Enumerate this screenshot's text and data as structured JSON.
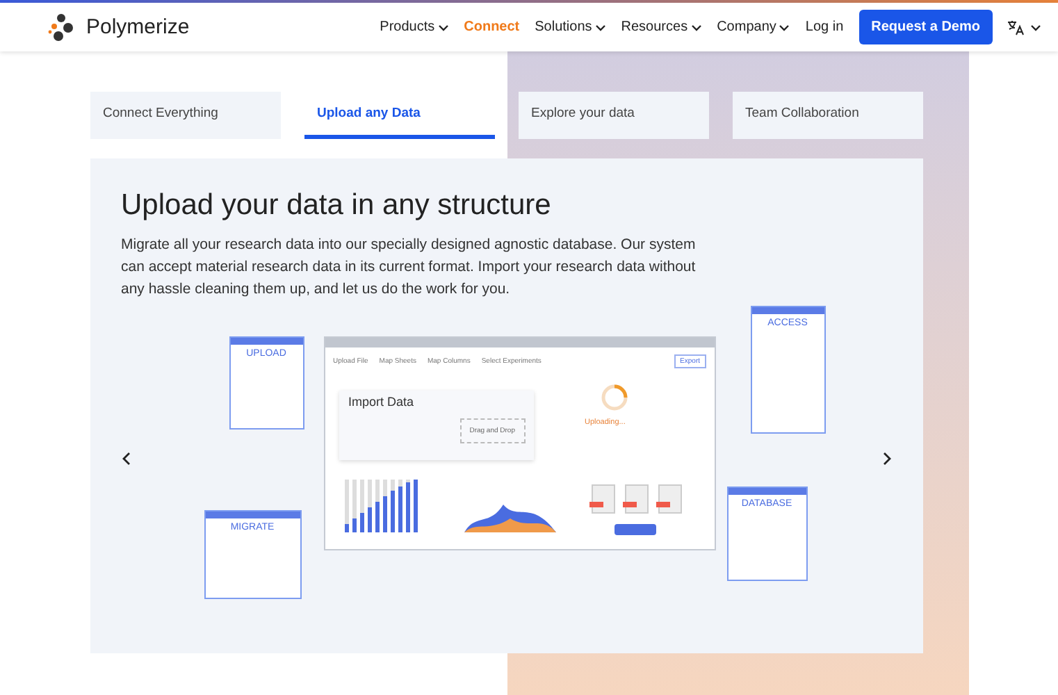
{
  "header": {
    "brand": "Polymerize",
    "nav": [
      {
        "label": "Products",
        "selected": false,
        "dropdown": true
      },
      {
        "label": "Connect",
        "selected": true,
        "dropdown": false
      },
      {
        "label": "Solutions",
        "selected": false,
        "dropdown": true
      },
      {
        "label": "Resources",
        "selected": false,
        "dropdown": true
      },
      {
        "label": "Company",
        "selected": false,
        "dropdown": true
      },
      {
        "label": "Log in",
        "selected": false,
        "dropdown": false
      }
    ],
    "cta": "Request a Demo"
  },
  "tabs": [
    {
      "label": "Connect Everything",
      "selected": false
    },
    {
      "label": "Upload any Data",
      "selected": true
    },
    {
      "label": "Explore your data",
      "selected": false
    },
    {
      "label": "Team Collaboration",
      "selected": false
    }
  ],
  "card": {
    "title": "Upload your data in any structure",
    "body": "Migrate all your research data into our specially designed agnostic database. Our system can accept material research data in its current format. Import your research data without any hassle cleaning them up, and let us do the work for you.",
    "illustration": {
      "panels": [
        "UPLOAD",
        "ACCESS",
        "MIGRATE",
        "DATABASE"
      ],
      "steps": [
        "Upload File",
        "Map Sheets",
        "Map Columns",
        "Select Experiments"
      ],
      "export": "Export",
      "import_title": "Import Data",
      "drop": "Drag and Drop",
      "status": "Uploading..."
    }
  }
}
